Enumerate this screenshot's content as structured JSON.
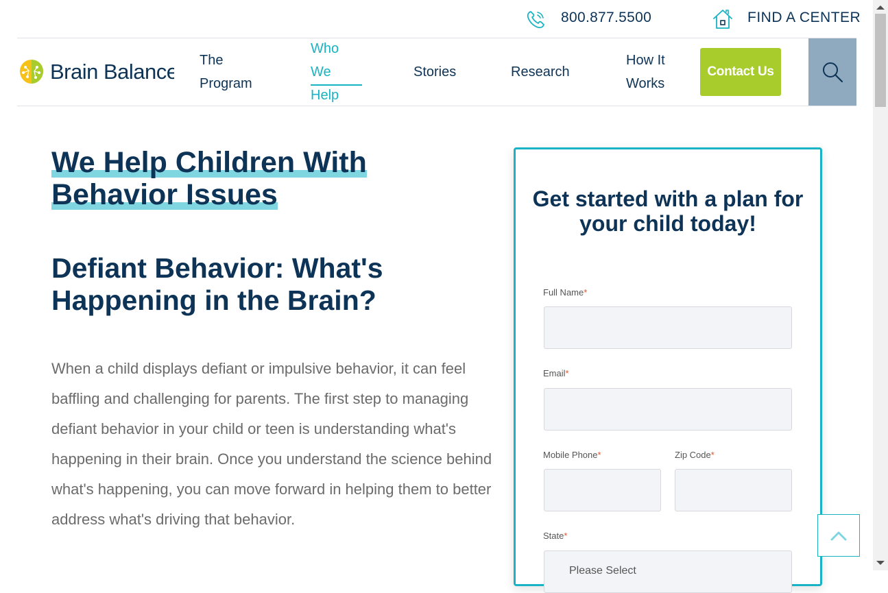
{
  "topbar": {
    "phone_icon": "phone-icon",
    "phone": "800.877.5500",
    "house_icon": "house-icon",
    "find_center": "FIND A CENTER"
  },
  "logo": {
    "icon": "brain-icon",
    "text": "Brain Balance"
  },
  "nav": {
    "items": [
      "The Program",
      "Who We Help",
      "Stories",
      "Research",
      "How It Works"
    ],
    "active": "Who We Help",
    "contact": "Contact Us",
    "search_icon": "search-icon"
  },
  "colors": {
    "navy": "#0d3356",
    "teal": "#18b3c4",
    "green": "#a8cc2c",
    "search_bg": "#8fa9bf",
    "highlight": "#7fd6e0"
  },
  "main": {
    "hero_title": "We Help Children With Behavior Issues",
    "sub_title": "Defiant Behavior: What's Happening in the Brain?",
    "body": "When a child displays defiant or impulsive behavior, it can feel baffling and challenging for parents. The first step to managing defiant behavior in your child or teen is understanding what's happening in their brain. Once you understand the science behind what's happening, you can move forward in helping them to better address what's driving that behavior."
  },
  "form": {
    "title": "Get started with a plan for your child today!",
    "required_mark": "*",
    "full_name_label": "Full Name",
    "full_name_value": "",
    "email_label": "Email",
    "email_value": "",
    "phone_label": "Mobile Phone",
    "phone_value": "",
    "zip_label": "Zip Code",
    "zip_value": "",
    "state_label": "State",
    "state_value": "Please Select"
  },
  "back_to_top_icon": "chevron-up-icon"
}
